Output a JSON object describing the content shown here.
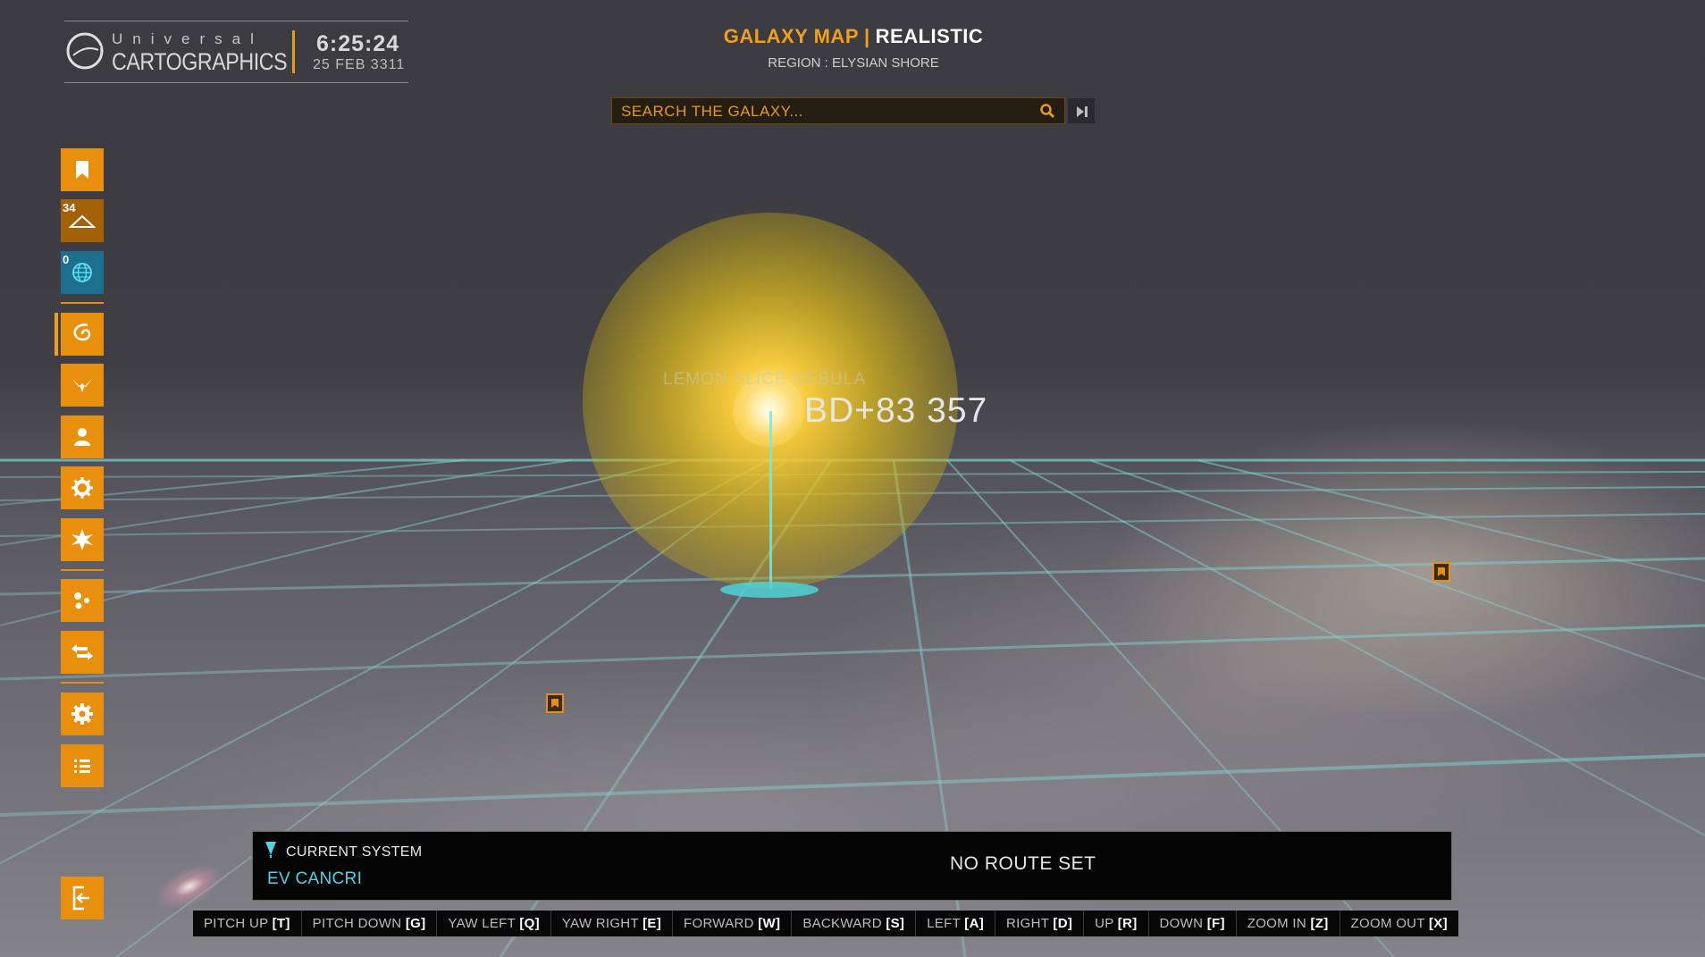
{
  "header": {
    "logo_top": "Universal",
    "logo_main": "CARTOGRAPHICS",
    "clock_time": "6:25:24",
    "clock_date": "25 FEB 3311"
  },
  "title": {
    "main": "GALAXY MAP",
    "separator": "|",
    "mode": "REALISTIC",
    "region": "REGION : ELYSIAN SHORE"
  },
  "search": {
    "placeholder": "SEARCH THE GALAXY..."
  },
  "sidebar": {
    "bookmarks_icon": "bookmark-icon",
    "tourist_count": "34",
    "exploration_count": "0"
  },
  "map": {
    "nebula_label": "LEMON SLICE NEBULA",
    "star_name": "BD+83 357"
  },
  "current_system": {
    "label": "CURRENT SYSTEM",
    "name": "EV CANCRI",
    "route_status": "NO ROUTE SET"
  },
  "controls": [
    {
      "action": "PITCH UP",
      "key": "[T]"
    },
    {
      "action": "PITCH DOWN",
      "key": "[G]"
    },
    {
      "action": "YAW LEFT",
      "key": "[Q]"
    },
    {
      "action": "YAW RIGHT",
      "key": "[E]"
    },
    {
      "action": "FORWARD",
      "key": "[W]"
    },
    {
      "action": "BACKWARD",
      "key": "[S]"
    },
    {
      "action": "LEFT",
      "key": "[A]"
    },
    {
      "action": "RIGHT",
      "key": "[D]"
    },
    {
      "action": "UP",
      "key": "[R]"
    },
    {
      "action": "DOWN",
      "key": "[F]"
    },
    {
      "action": "ZOOM IN",
      "key": "[Z]"
    },
    {
      "action": "ZOOM OUT",
      "key": "[X]"
    }
  ],
  "colors": {
    "accent_orange": "#e8900e",
    "title_orange": "#f0a020",
    "cyan": "#4ed4e6",
    "panel_black": "#050505"
  }
}
